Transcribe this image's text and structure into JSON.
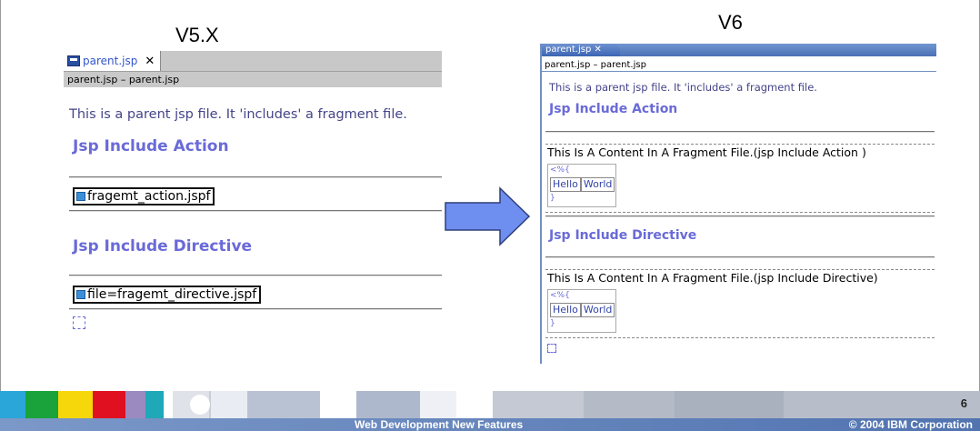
{
  "slide": {
    "v5_title": "V5.X",
    "v6_title": "V6",
    "page_number": "6",
    "footer_title": "Web Development New Features",
    "footer_copyright": "© 2004 IBM Corporation"
  },
  "v5": {
    "tab_label": "parent.jsp",
    "tab_close": "✕",
    "breadcrumb": "parent.jsp – parent.jsp",
    "paragraph": "This is a parent jsp file. It 'includes' a fragment file.",
    "heading_action": "Jsp Include Action",
    "tag_action": "fragemt_action.jspf",
    "heading_directive": "Jsp Include Directive",
    "tag_directive": "file=fragemt_directive.jspf"
  },
  "v6": {
    "tab_label": "parent.jsp ✕",
    "breadcrumb": "parent.jsp – parent.jsp",
    "paragraph": "This is a parent jsp file. It 'includes' a fragment file.",
    "heading_action": "Jsp Include Action",
    "fragment_action": "This Is A Content In A Fragment File.(jsp Include Action )",
    "heading_directive": "Jsp Include Directive",
    "fragment_directive": "This Is A Content In A Fragment File.(jsp Include Directive)",
    "table_cell_1": "Hello",
    "table_cell_2": "World",
    "code_open": "<%{",
    "code_close": "}"
  },
  "colors": {
    "heading": "#6a6ad8",
    "arrow_fill": "#6e8ef0",
    "footer_bar": "#5173b0"
  }
}
